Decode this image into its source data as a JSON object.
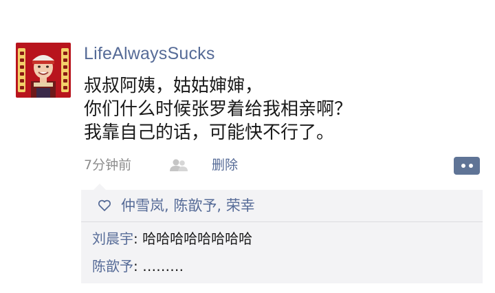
{
  "post": {
    "username": "LifeAlwaysSucks",
    "lines": [
      "叔叔阿姨，姑姑婶婶，",
      "你们什么时候张罗着给我相亲啊？",
      "我靠自己的话，可能快不行了。"
    ],
    "timestamp": "7分钟前",
    "delete_label": "删除",
    "avatar_icon": "profile-photo",
    "visibility_icon": "contacts-icon",
    "comment_icon": "comment-dots-icon"
  },
  "interactions": {
    "like_icon": "heart-icon",
    "likes": "仲雪岚, 陈歆予, 荣幸",
    "comments": [
      {
        "author": "刘晨宇",
        "separator": ": ",
        "text": "哈哈哈哈哈哈哈哈"
      },
      {
        "author": "陈歆予",
        "separator": ": ",
        "text": "………"
      }
    ]
  },
  "colors": {
    "link": "#566b97",
    "text": "#1a1a1a",
    "meta": "#8c8c8c",
    "box_bg": "#f3f3f5",
    "comment_button": "#5f7496"
  }
}
